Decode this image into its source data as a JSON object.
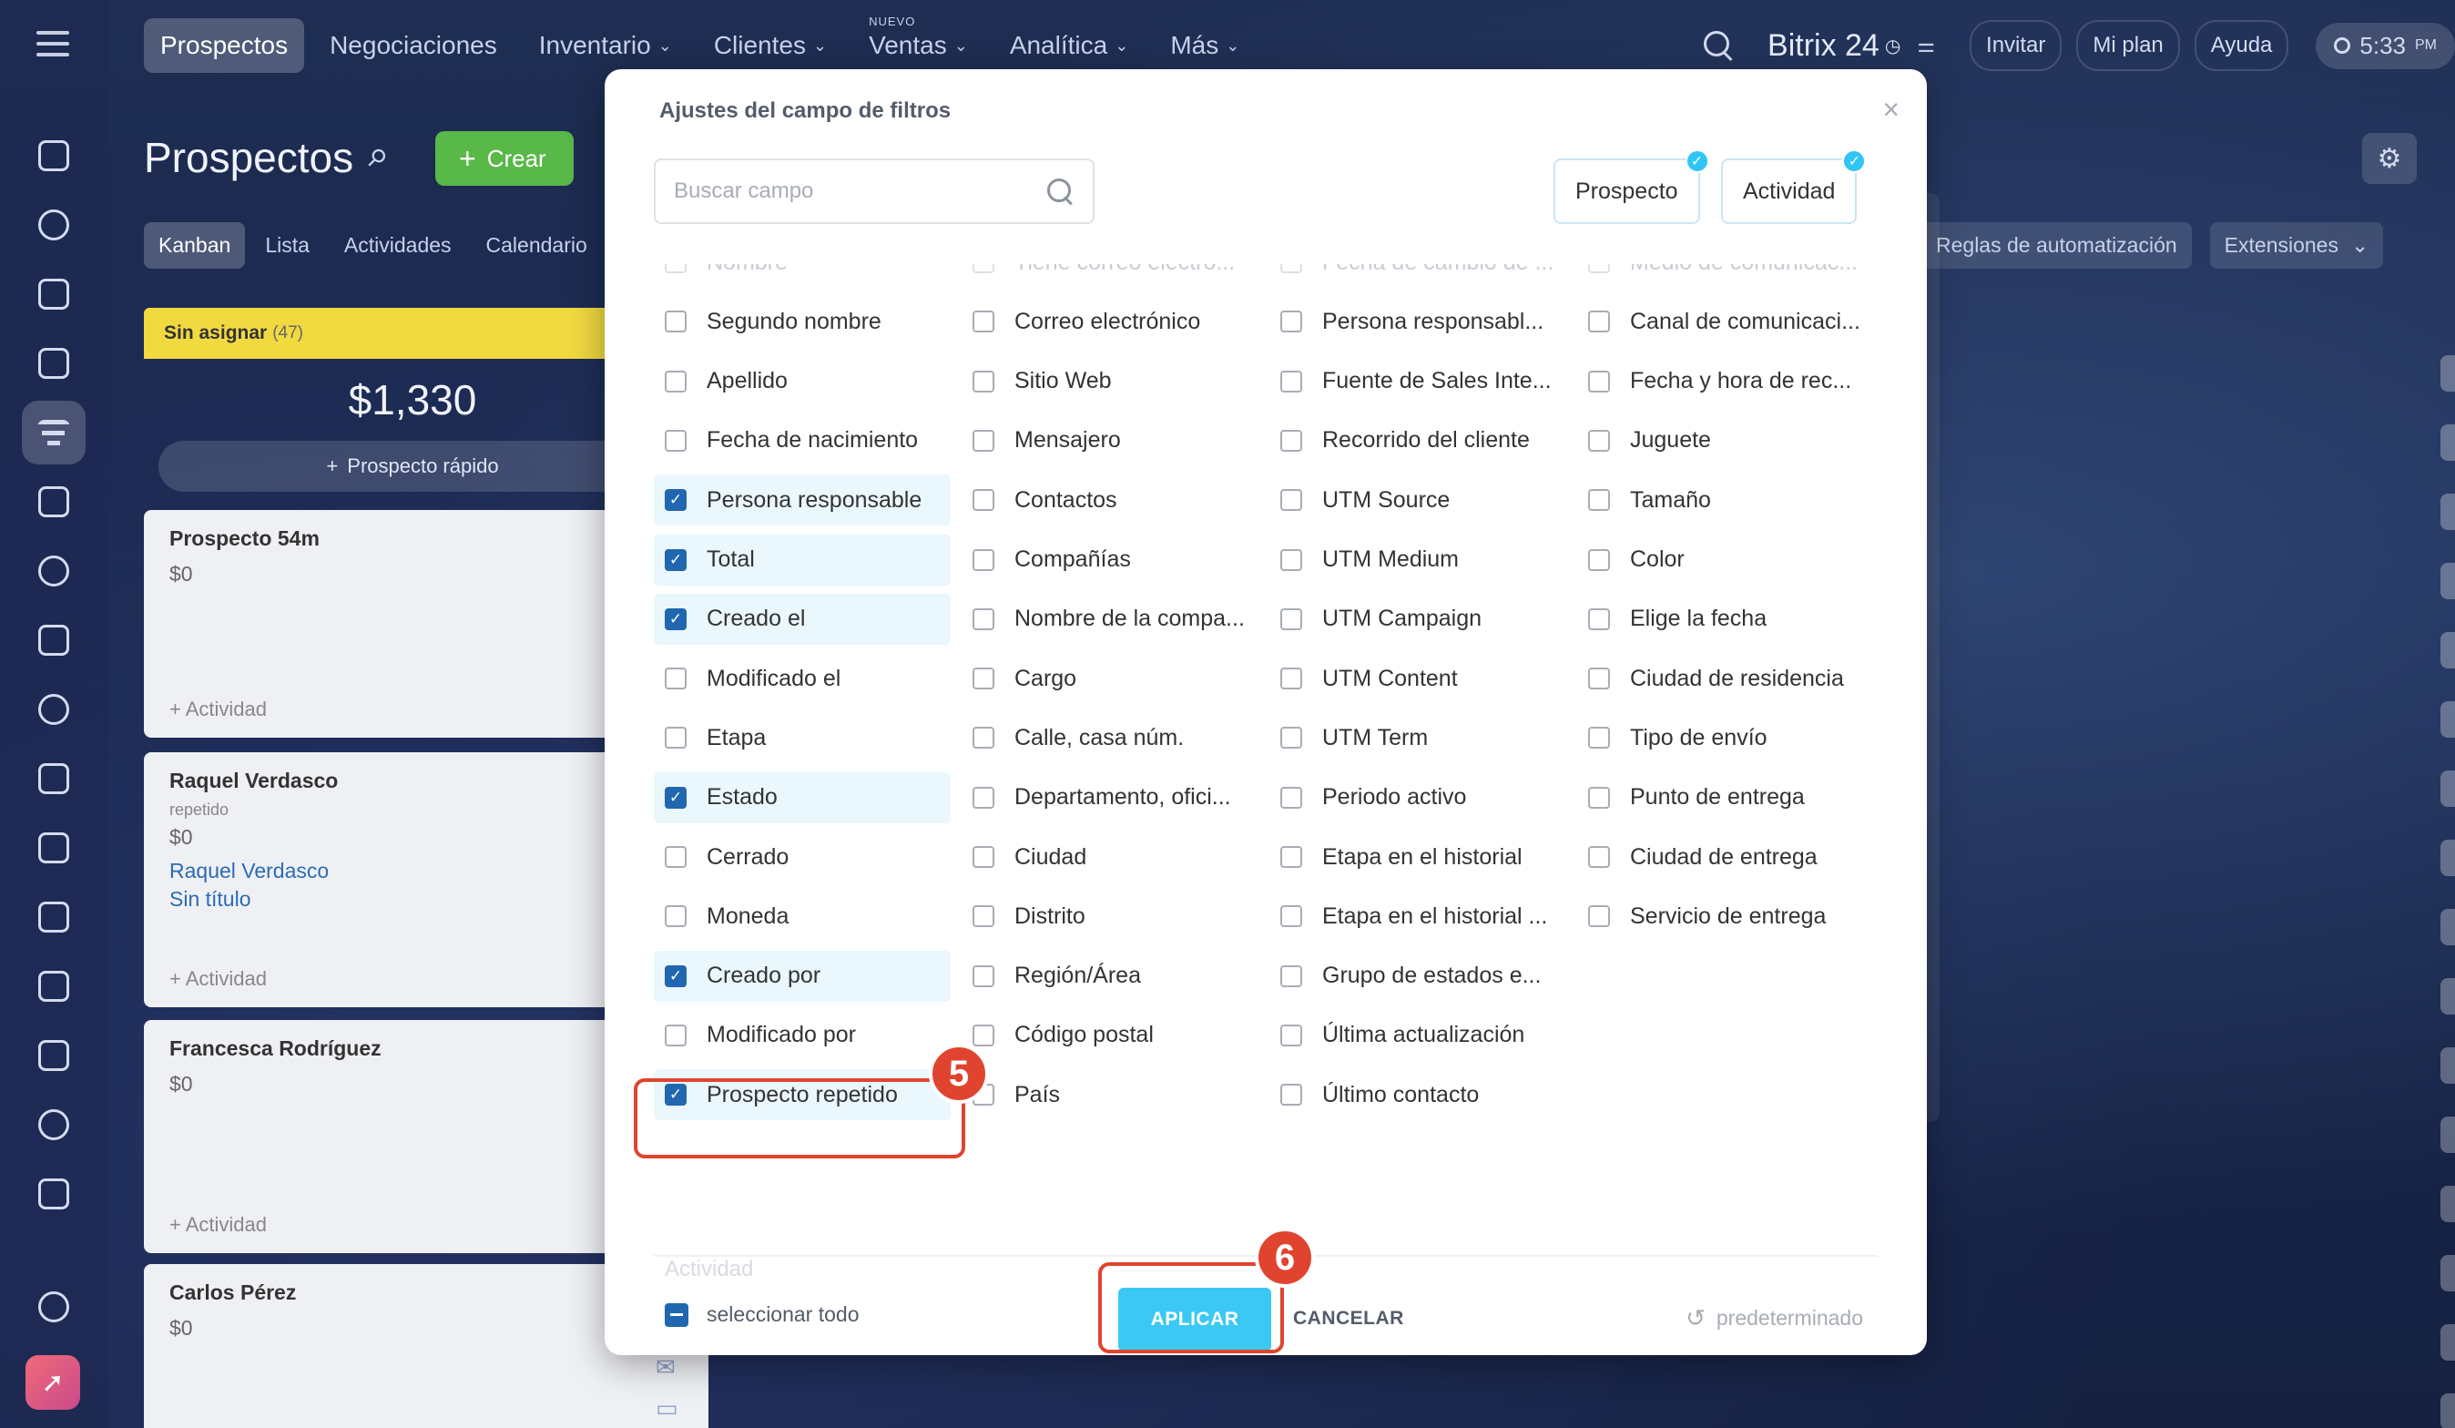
{
  "topnav": {
    "items": [
      {
        "label": "Prospectos",
        "active": true,
        "caret": false
      },
      {
        "label": "Negociaciones",
        "active": false,
        "caret": false
      },
      {
        "label": "Inventario",
        "active": false,
        "caret": true
      },
      {
        "label": "Clientes",
        "active": false,
        "caret": true
      },
      {
        "label": "Ventas",
        "active": false,
        "caret": true,
        "badge": "NUEVO"
      },
      {
        "label": "Analítica",
        "active": false,
        "caret": true
      },
      {
        "label": "Más",
        "active": false,
        "caret": true
      }
    ],
    "brand": "Bitrix 24",
    "invite": "Invitar",
    "plan": "Mi plan",
    "help": "Ayuda",
    "time": "5:33",
    "ampm": "PM"
  },
  "page": {
    "title": "Prospectos",
    "create_label": "Crear",
    "view_tabs": [
      "Kanban",
      "Lista",
      "Actividades",
      "Calendario"
    ],
    "automation": "Reglas de automatización",
    "extensions": "Extensiones"
  },
  "column": {
    "name": "Sin asignar",
    "count": "(47)",
    "sum": "$1,330",
    "quick_lead": "Prospecto rápido"
  },
  "cards": [
    {
      "name": "Prospecto 54m",
      "rep": "",
      "amount": "$0",
      "links": [],
      "activity": "+ Actividad"
    },
    {
      "name": "Raquel Verdasco",
      "rep": "repetido",
      "amount": "$0",
      "links": [
        "Raquel Verdasco",
        "Sin título"
      ],
      "activity": "+ Actividad"
    },
    {
      "name": "Francesca Rodríguez",
      "rep": "",
      "amount": "$0",
      "links": [],
      "activity": "+ Actividad"
    },
    {
      "name": "Carlos Pérez",
      "rep": "",
      "amount": "$0",
      "links": [],
      "activity": ""
    }
  ],
  "modal": {
    "title": "Ajustes del campo de filtros",
    "search_placeholder": "Buscar campo",
    "tags": [
      "Prospecto",
      "Actividad"
    ],
    "columns": [
      [
        {
          "label": "Nombre",
          "checked": false,
          "faded": true
        },
        {
          "label": "Segundo nombre",
          "checked": false
        },
        {
          "label": "Apellido",
          "checked": false
        },
        {
          "label": "Fecha de nacimiento",
          "checked": false
        },
        {
          "label": "Persona responsable",
          "checked": true
        },
        {
          "label": "Total",
          "checked": true
        },
        {
          "label": "Creado el",
          "checked": true
        },
        {
          "label": "Modificado el",
          "checked": false
        },
        {
          "label": "Etapa",
          "checked": false
        },
        {
          "label": "Estado",
          "checked": true
        },
        {
          "label": "Cerrado",
          "checked": false
        },
        {
          "label": "Moneda",
          "checked": false
        },
        {
          "label": "Creado por",
          "checked": true
        },
        {
          "label": "Modificado por",
          "checked": false
        },
        {
          "label": "Prospecto repetido",
          "checked": true
        }
      ],
      [
        {
          "label": "Tiene correo electró...",
          "checked": false,
          "faded": true
        },
        {
          "label": "Correo electrónico",
          "checked": false
        },
        {
          "label": "Sitio Web",
          "checked": false
        },
        {
          "label": "Mensajero",
          "checked": false
        },
        {
          "label": "Contactos",
          "checked": false
        },
        {
          "label": "Compañías",
          "checked": false
        },
        {
          "label": "Nombre de la compa...",
          "checked": false
        },
        {
          "label": "Cargo",
          "checked": false
        },
        {
          "label": "Calle, casa núm.",
          "checked": false
        },
        {
          "label": "Departamento, ofici...",
          "checked": false
        },
        {
          "label": "Ciudad",
          "checked": false
        },
        {
          "label": "Distrito",
          "checked": false
        },
        {
          "label": "Región/Área",
          "checked": false
        },
        {
          "label": "Código postal",
          "checked": false
        },
        {
          "label": "País",
          "checked": false
        }
      ],
      [
        {
          "label": "Fecha de cambio de ...",
          "checked": false,
          "faded": true
        },
        {
          "label": "Persona responsabl...",
          "checked": false
        },
        {
          "label": "Fuente de Sales Inte...",
          "checked": false
        },
        {
          "label": "Recorrido del cliente",
          "checked": false
        },
        {
          "label": "UTM Source",
          "checked": false
        },
        {
          "label": "UTM Medium",
          "checked": false
        },
        {
          "label": "UTM Campaign",
          "checked": false
        },
        {
          "label": "UTM Content",
          "checked": false
        },
        {
          "label": "UTM Term",
          "checked": false
        },
        {
          "label": "Periodo activo",
          "checked": false
        },
        {
          "label": "Etapa en el historial",
          "checked": false
        },
        {
          "label": "Etapa en el historial ...",
          "checked": false
        },
        {
          "label": "Grupo de estados e...",
          "checked": false
        },
        {
          "label": "Última actualización",
          "checked": false
        },
        {
          "label": "Último contacto",
          "checked": false
        }
      ],
      [
        {
          "label": "Medio de comunicac...",
          "checked": false,
          "faded": true
        },
        {
          "label": "Canal de comunicaci...",
          "checked": false
        },
        {
          "label": "Fecha y hora de rec...",
          "checked": false
        },
        {
          "label": "Juguete",
          "checked": false
        },
        {
          "label": "Tamaño",
          "checked": false
        },
        {
          "label": "Color",
          "checked": false
        },
        {
          "label": "Elige la fecha",
          "checked": false
        },
        {
          "label": "Ciudad de residencia",
          "checked": false
        },
        {
          "label": "Tipo de envío",
          "checked": false
        },
        {
          "label": "Punto de entrega",
          "checked": false
        },
        {
          "label": "Ciudad de entrega",
          "checked": false
        },
        {
          "label": "Servicio de entrega",
          "checked": false
        }
      ]
    ],
    "next_section": "Actividad",
    "select_all": "seleccionar todo",
    "apply": "APLICAR",
    "cancel": "CANCELAR",
    "default": "predeterminado"
  },
  "annotations": {
    "step_a": "5",
    "step_b": "6",
    "color": "#e0442f"
  }
}
